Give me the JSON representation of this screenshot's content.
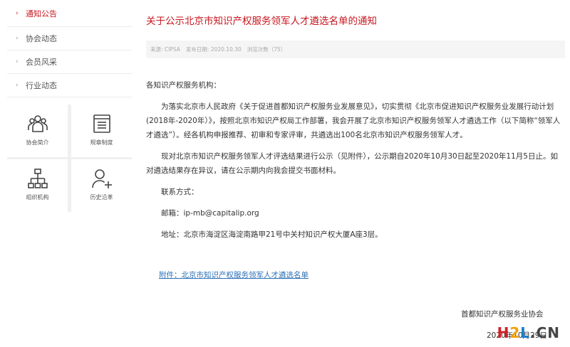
{
  "sidebar": {
    "items": [
      {
        "label": "通知公告",
        "active": true
      },
      {
        "label": "协会动态",
        "active": false
      },
      {
        "label": "会员风采",
        "active": false
      },
      {
        "label": "行业动态",
        "active": false
      }
    ],
    "tiles": [
      {
        "label": "协会简介",
        "icon": "team-icon"
      },
      {
        "label": "规章制度",
        "icon": "document-icon"
      },
      {
        "label": "组织机构",
        "icon": "org-chart-icon"
      },
      {
        "label": "历史沿革",
        "icon": "history-icon"
      }
    ]
  },
  "article": {
    "title": "关于公示北京市知识产权服务领军人才遴选名单的通知",
    "meta": {
      "source": "来源: CIPSA",
      "date": "发布日期: 2020.10.30",
      "views": "浏览次数（75）"
    },
    "greeting": "各知识产权服务机构：",
    "para1": "为落实北京市人民政府《关于促进首都知识产权服务业发展意见》，切实贯彻《北京市促进知识产权服务业发展行动计划(2018年-2020年）》，按照北京市知识产权局工作部署，我会开展了北京市知识产权服务领军人才遴选工作（以下简称“领军人才遴选”）。经各机构申报推荐、初审和专家评审，共遴选出100名北京市知识产权服务领军人才。",
    "para2": "现对北京市知识产权服务领军人才评选结果进行公示（见附件），公示期自2020年10月30日起至2020年11月5日止。如对遴选结果存在异议，请在公示期内向我会提交书面材料。",
    "contact_label": "联系方式：",
    "email": "邮箱：ip-mb@capitalip.org",
    "address": "地址：北京市海淀区海淀南路甲21号中关村知识产权大厦A座3层。",
    "attachment": "附件：北京市知识产权服务领军人才遴选名单",
    "signature": "首都知识产权服务业协会",
    "date": "2020年10月29日"
  },
  "watermark": {
    "h": "H",
    "two": "2",
    "l": "L",
    "cn": ".CN"
  },
  "colors": {
    "accent": "#c8161e",
    "link": "#2a6fb5"
  }
}
